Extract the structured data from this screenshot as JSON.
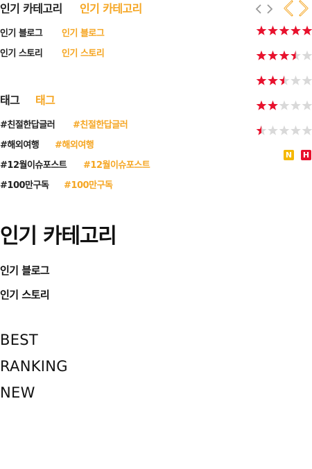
{
  "top": {
    "category_title": "인기 카테고리",
    "category_title_hover": "인기 카테고리",
    "links": [
      {
        "label": "인기 블로그",
        "hover": "인기 블로그"
      },
      {
        "label": "인기 스토리",
        "hover": "인기 스토리"
      }
    ],
    "tag_title": "태그",
    "tag_title_hover": "태그",
    "tags": [
      {
        "label": "#친절한답글러",
        "hover": "#친절한답글러"
      },
      {
        "label": "#해외여행",
        "hover": "#해외여행"
      },
      {
        "label": "#12월이슈포스트",
        "hover": "#12월이슈포스트"
      },
      {
        "label": "#100만구독",
        "hover": "#100만구독"
      }
    ]
  },
  "icons": {
    "arrows_small": [
      "chevron-left-icon",
      "chevron-right-icon"
    ],
    "arrows_large": [
      "chevron-left-icon",
      "chevron-right-icon"
    ]
  },
  "ratings": [
    5,
    3.5,
    2.5,
    2,
    0.5
  ],
  "rating_max": 5,
  "badges": [
    {
      "label": "N",
      "color": "#f5b800"
    },
    {
      "label": "H",
      "color": "#e8112d"
    }
  ],
  "section": {
    "title": "인기 카테고리",
    "links": [
      "인기 블로그",
      "인기 스토리"
    ]
  },
  "menu": [
    "BEST",
    "RANKING",
    "NEW"
  ],
  "colors": {
    "accent": "#f5a623",
    "star_on": "#e8112d",
    "star_off": "#d9d9d9",
    "text": "#222222"
  }
}
